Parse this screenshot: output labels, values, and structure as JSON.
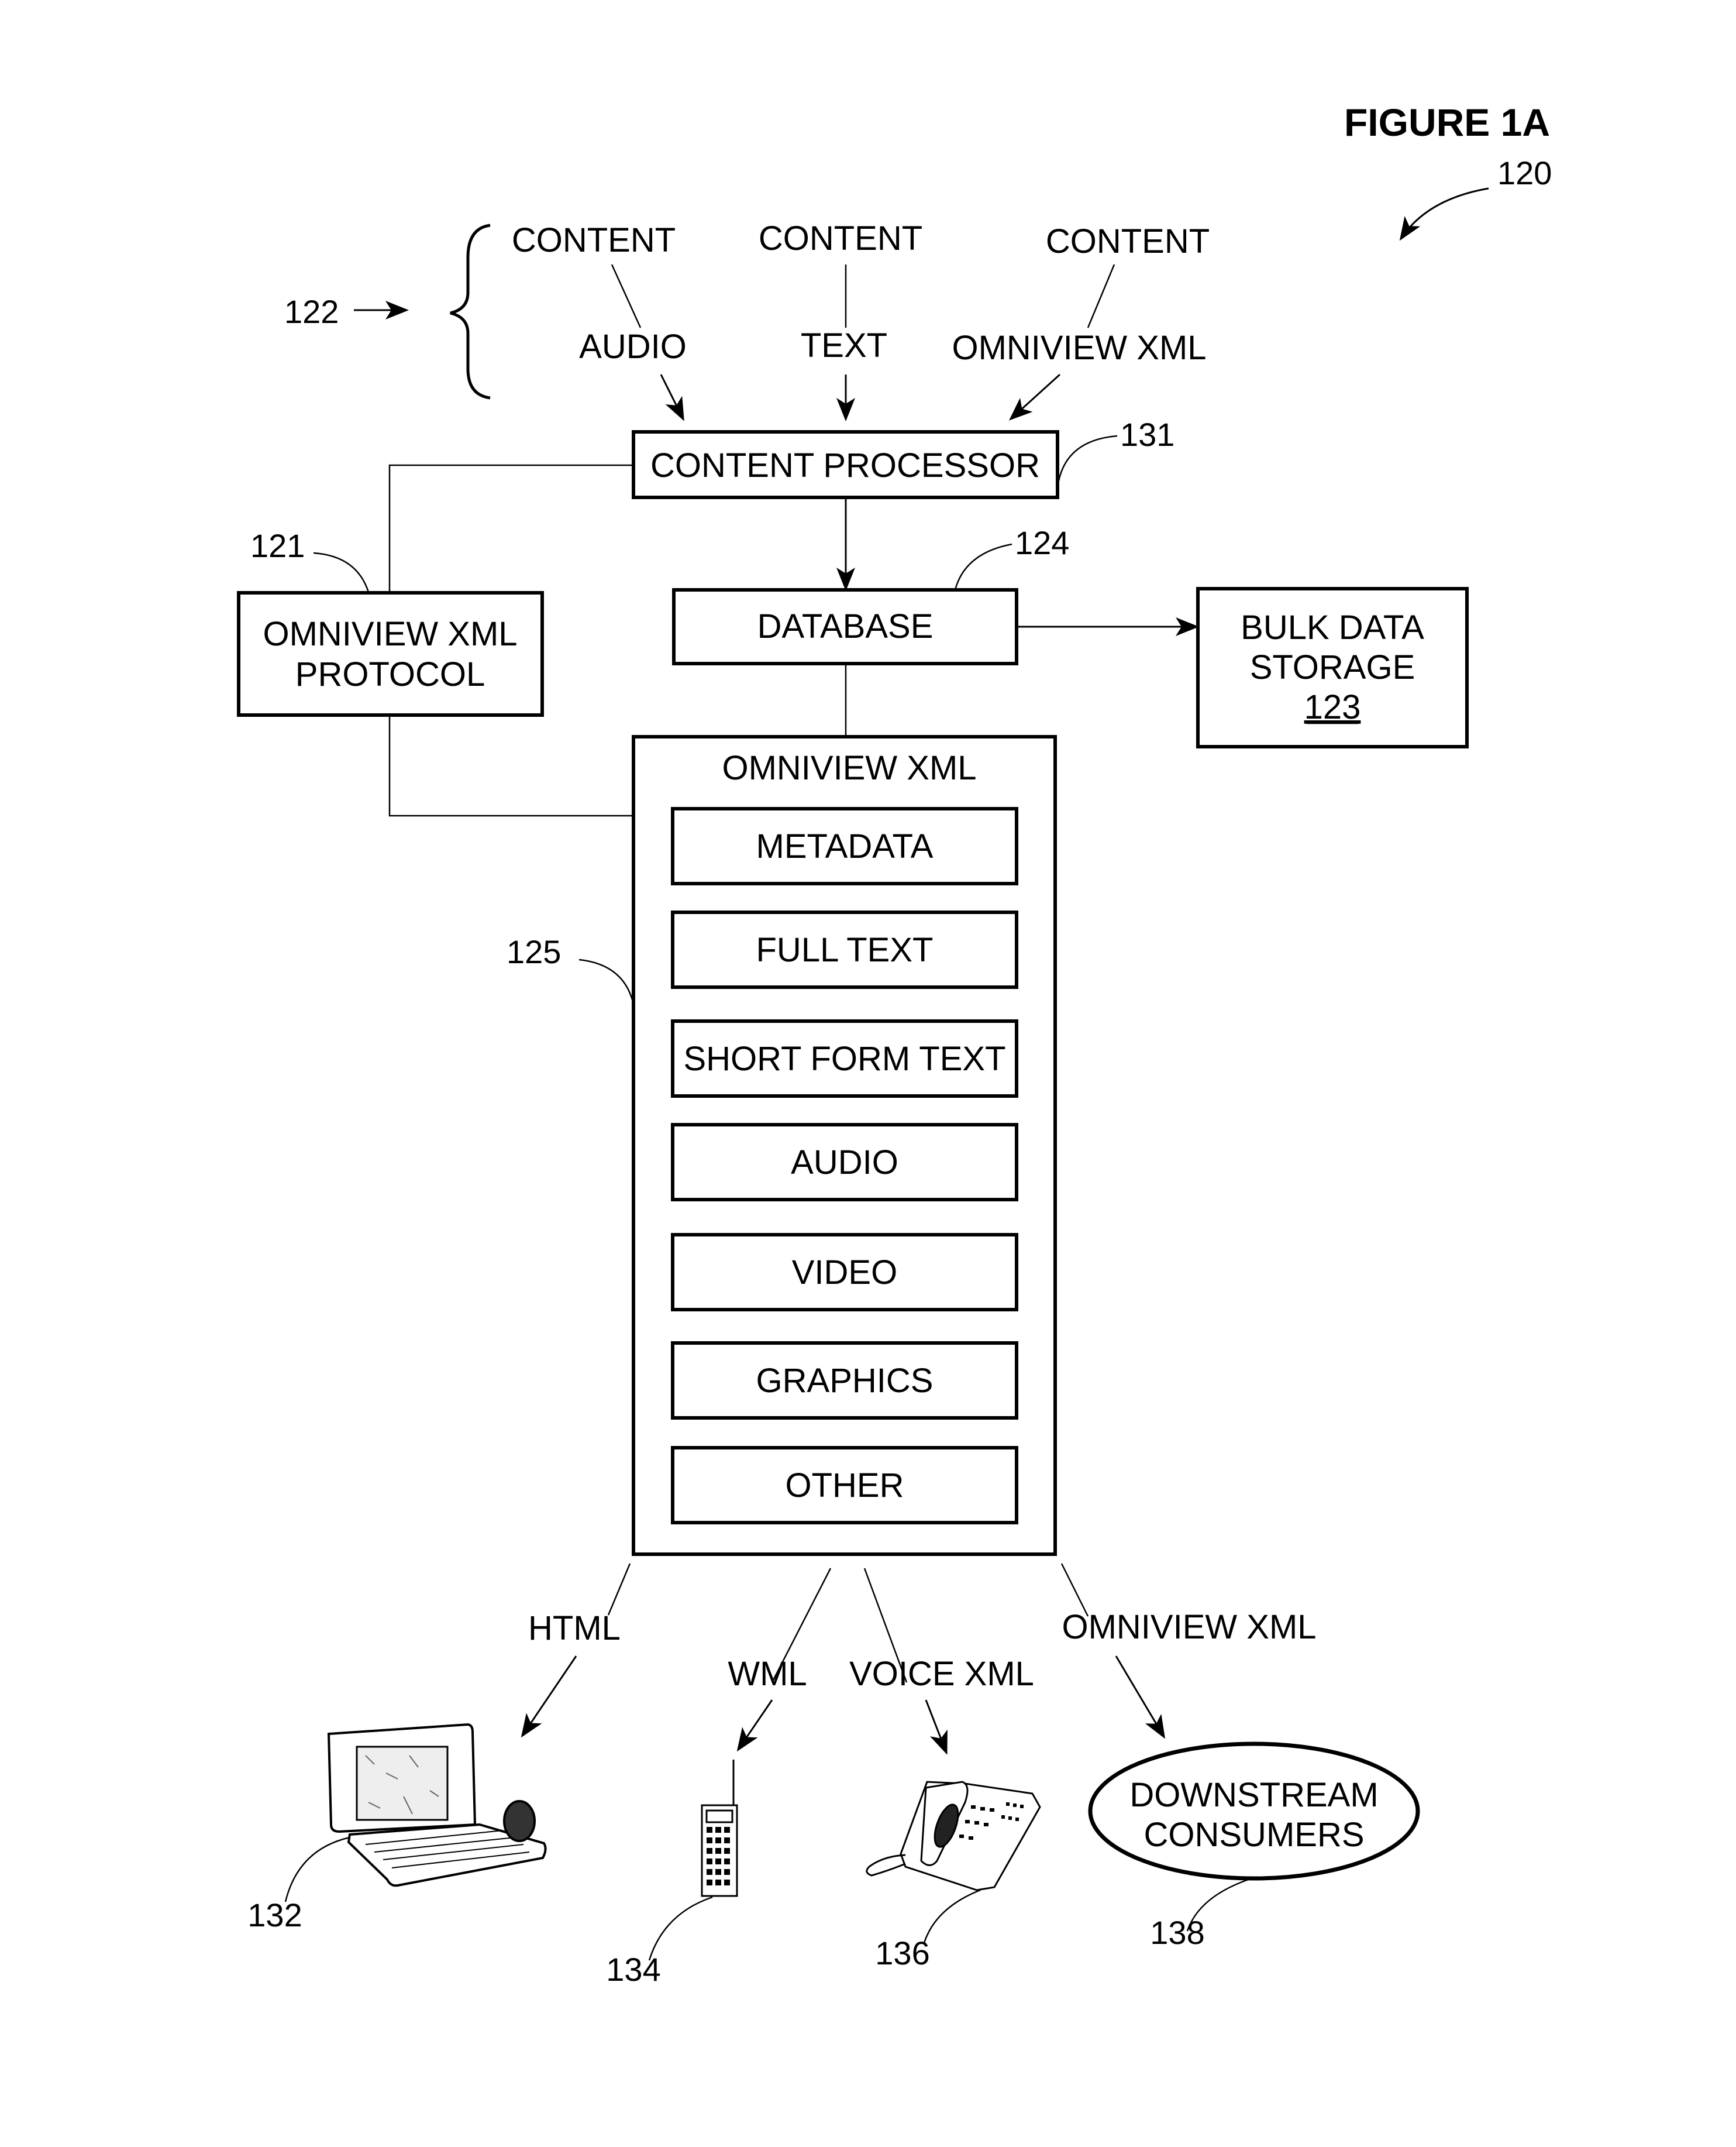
{
  "figure": {
    "title": "FIGURE 1A",
    "ref": "120"
  },
  "sources": {
    "ref": "122",
    "items": [
      {
        "top": "CONTENT",
        "bottom": "AUDIO"
      },
      {
        "top": "CONTENT",
        "bottom": "TEXT"
      },
      {
        "top": "CONTENT",
        "bottom": "OMNIVIEW XML"
      }
    ]
  },
  "content_processor": {
    "label": "CONTENT PROCESSOR",
    "ref": "131"
  },
  "protocol": {
    "line1": "OMNIVIEW XML",
    "line2": "PROTOCOL",
    "ref": "121"
  },
  "database": {
    "label": "DATABASE",
    "ref": "124"
  },
  "bulk_storage": {
    "line1": "BULK DATA",
    "line2": "STORAGE",
    "ref": "123"
  },
  "omniview": {
    "title": "OMNIVIEW XML",
    "ref": "125",
    "items": [
      "METADATA",
      "FULL TEXT",
      "SHORT FORM TEXT",
      "AUDIO",
      "VIDEO",
      "GRAPHICS",
      "OTHER"
    ]
  },
  "outputs": [
    {
      "format": "HTML",
      "device": "laptop",
      "ref": "132"
    },
    {
      "format": "WML",
      "device": "mobile-phone",
      "ref": "134"
    },
    {
      "format": "VOICE XML",
      "device": "telephone",
      "ref": "136"
    },
    {
      "format": "OMNIVIEW XML",
      "device": "downstream-consumers",
      "ref": "138"
    }
  ],
  "downstream": {
    "line1": "DOWNSTREAM",
    "line2": "CONSUMERS"
  }
}
